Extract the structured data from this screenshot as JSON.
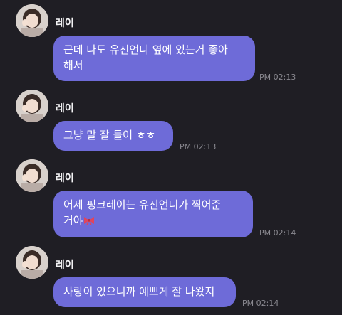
{
  "messages": [
    {
      "sender": "레이",
      "lines": [
        "근데 나도 유진언니 옆에 있는거 좋아",
        "해서"
      ],
      "time": "PM 02:13"
    },
    {
      "sender": "레이",
      "lines": [
        "그냥 말 잘 들어 ㅎㅎ"
      ],
      "time": "PM 02:13"
    },
    {
      "sender": "레이",
      "lines": [
        "어제 핑크레이는 유진언니가 찍어준",
        "거야"
      ],
      "emoji": "ribbon-icon",
      "time": "PM 02:14"
    },
    {
      "sender": "레이",
      "lines": [
        "사랑이 있으니까 예쁘게 잘 나왔지"
      ],
      "time": "PM 02:14"
    }
  ],
  "colors": {
    "background": "#1f1e24",
    "bubble": "#6e6bd8",
    "timestamp": "#8a8990"
  }
}
